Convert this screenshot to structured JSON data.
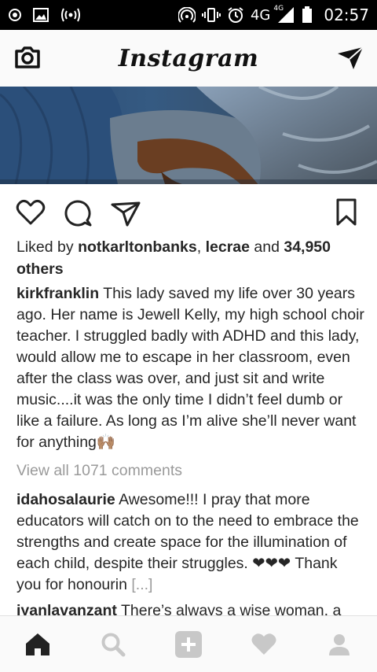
{
  "status_bar": {
    "network": "4G",
    "network_small": "4G",
    "time": "02:57"
  },
  "header": {
    "title": "Instagram"
  },
  "post": {
    "likes": {
      "prefix": "Liked by ",
      "user1": "notkarltonbanks",
      "sep": ", ",
      "user2": "lecrae",
      "and": " and ",
      "count": "34,950",
      "others": "others"
    },
    "caption": {
      "username": "kirkfranklin",
      "text": "This lady saved my life over 30 years ago. Her name is Jewell Kelly, my high school choir teacher. I struggled badly with ADHD and this lady, would allow me to escape in her classroom, even after the class was over, and just sit and write music....it was the only time I didn’t feel dumb or like a failure. As long as I’m alive she’ll never want for anything🙌🏽"
    },
    "view_all_comments": "View all 1071 comments",
    "comments": [
      {
        "username": "idahosalaurie",
        "text": "Awesome!!! I pray that more educators will catch on to the need to embrace the strengths and create space for the illumination of each child, despite their struggles. ❤❤❤ Thank you for honourin",
        "more": "[...]"
      },
      {
        "username": "iyanlavanzant",
        "text": "There’s always a wise woman, a"
      }
    ]
  },
  "bottom_nav": {
    "items": [
      "home-icon",
      "search-icon",
      "add-icon",
      "heart-icon",
      "profile-icon"
    ]
  }
}
